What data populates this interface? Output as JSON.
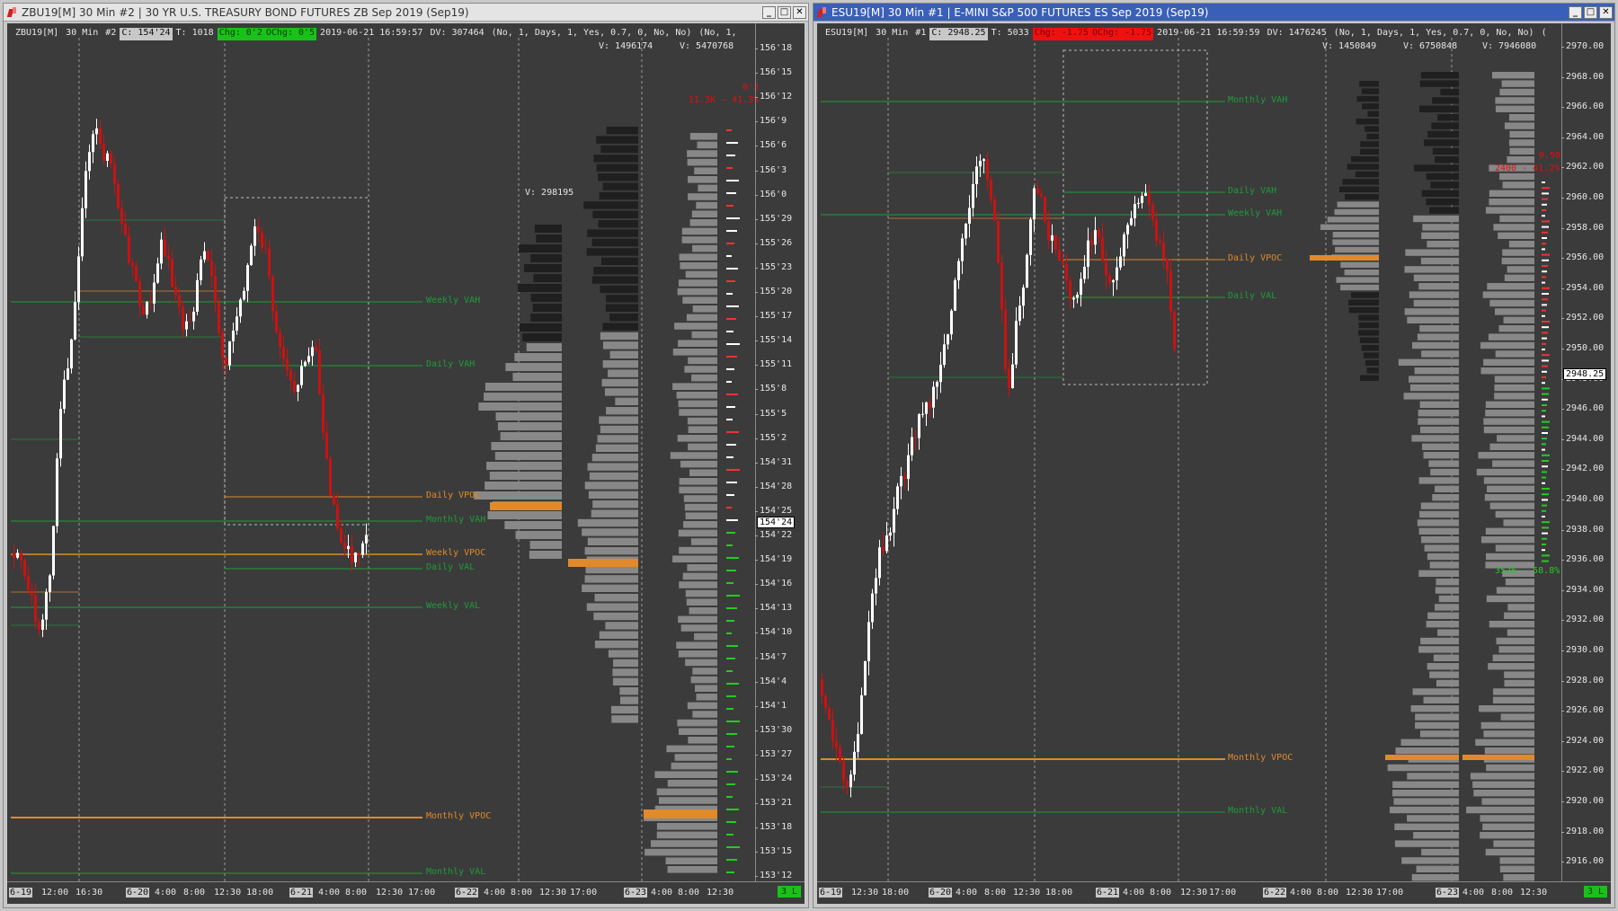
{
  "left": {
    "title": "ZBU19[M]  30 Min   #2 | 30 YR U.S. TREASURY BOND FUTURES ZB Sep 2019 (Sep19)",
    "info": {
      "symbol": "ZBU19[M]",
      "interval": "30 Min",
      "idx": "#2",
      "close": "C: 154'24",
      "trades": "T: 1018",
      "chg": "Chg: 0'2",
      "ochg": "OChg: 0'5",
      "datetime": "2019-06-21 16:59:57",
      "dv": "DV: 307464",
      "params": "(No, 1, Days, 1, Yes, 0.7, 0, No, No)",
      "params2": "(No, 1,"
    },
    "vol_labels": [
      "V: 1496174",
      "V: 5470768",
      "V: 298195"
    ],
    "delta_labels": [
      "0'3",
      "11.3K - 41.3%"
    ],
    "levels": [
      {
        "text": "Weekly VAH",
        "color": "#1f9c3a"
      },
      {
        "text": "Daily VAH",
        "color": "#1f9c3a"
      },
      {
        "text": "Daily VPOC",
        "color": "#e08a2a"
      },
      {
        "text": "Monthly VAH",
        "color": "#1f9c3a"
      },
      {
        "text": "Weekly VPOC",
        "color": "#e08a2a"
      },
      {
        "text": "Daily VAL",
        "color": "#1f9c3a"
      },
      {
        "text": "Weekly VAL",
        "color": "#1f9c3a"
      },
      {
        "text": "Monthly VPOC",
        "color": "#e08a2a"
      },
      {
        "text": "Monthly VAL",
        "color": "#1f9c3a"
      }
    ],
    "price_ticks": [
      "156'18",
      "156'15",
      "156'12",
      "156'9",
      "156'6",
      "156'3",
      "156'0",
      "155'29",
      "155'26",
      "155'23",
      "155'20",
      "155'17",
      "155'14",
      "155'11",
      "155'8",
      "155'5",
      "155'2",
      "154'31",
      "154'28",
      "154'25",
      "154'22",
      "154'19",
      "154'16",
      "154'13",
      "154'10",
      "154'7",
      "154'4",
      "154'1",
      "153'30",
      "153'27",
      "153'24",
      "153'21",
      "153'18",
      "153'15",
      "153'12"
    ],
    "current_price": "154'24",
    "time_labels": [
      "6-19",
      "12:00",
      "16:30",
      "6-20",
      "4:00",
      "8:00",
      "12:30",
      "18:00",
      "6-21",
      "4:00",
      "8:00",
      "12:30",
      "17:00",
      "6-22",
      "4:00",
      "8:00",
      "12:30",
      "17:00",
      "6-23",
      "4:00",
      "8:00",
      "12:30"
    ],
    "status": "3 L"
  },
  "right": {
    "title": "ESU19[M]  30 Min   #1 | E-MINI S&P 500 FUTURES ES Sep 2019 (Sep19)",
    "info": {
      "symbol": "ESU19[M]",
      "interval": "30 Min",
      "idx": "#1",
      "close": "C: 2948.25",
      "trades": "T: 5033",
      "chg": "Chg: -1.75",
      "ochg": "OChg: -1.75",
      "datetime": "2019-06-21 16:59:59",
      "dv": "DV: 1476245",
      "params": "(No, 1, Days, 1, Yes, 0.7, 0, No, No)",
      "params2": "("
    },
    "vol_labels": [
      "V: 1450849",
      "V: 6750848",
      "V: 7946080"
    ],
    "delta_labels": [
      "0.50",
      "2400 - 41.2%",
      "3526 - 58.8%"
    ],
    "levels": [
      {
        "text": "Monthly VAH",
        "color": "#1f9c3a"
      },
      {
        "text": "Daily VAH",
        "color": "#1f9c3a"
      },
      {
        "text": "Weekly VAH",
        "color": "#1f9c3a"
      },
      {
        "text": "Daily VPOC",
        "color": "#e08a2a"
      },
      {
        "text": "Daily VAL",
        "color": "#1f9c3a"
      },
      {
        "text": "Monthly VPOC",
        "color": "#e08a2a"
      },
      {
        "text": "Monthly VAL",
        "color": "#1f9c3a"
      }
    ],
    "price_ticks": [
      "2970.00",
      "2968.00",
      "2966.00",
      "2964.00",
      "2962.00",
      "2960.00",
      "2958.00",
      "2956.00",
      "2954.00",
      "2952.00",
      "2950.00",
      "2948.00",
      "2946.00",
      "2944.00",
      "2942.00",
      "2940.00",
      "2938.00",
      "2936.00",
      "2934.00",
      "2932.00",
      "2930.00",
      "2928.00",
      "2926.00",
      "2924.00",
      "2922.00",
      "2920.00",
      "2918.00",
      "2916.00"
    ],
    "current_price": "2948.25",
    "time_labels": [
      "6-19",
      "12:30",
      "18:00",
      "6-20",
      "4:00",
      "8:00",
      "12:30",
      "18:00",
      "6-21",
      "4:00",
      "8:00",
      "12:30",
      "17:00",
      "6-22",
      "4:00",
      "8:00",
      "12:30",
      "17:00",
      "6-23",
      "4:00",
      "8:00",
      "12:30"
    ],
    "status": "3 L"
  },
  "colors": {
    "bg": "#3b3b3b",
    "up": "#ffffff",
    "down": "#cc1111",
    "value_area": "#1f9c3a",
    "vpoc": "#e08a2a",
    "profile_gray": "#888888",
    "profile_dark": "#1f1f1f"
  }
}
